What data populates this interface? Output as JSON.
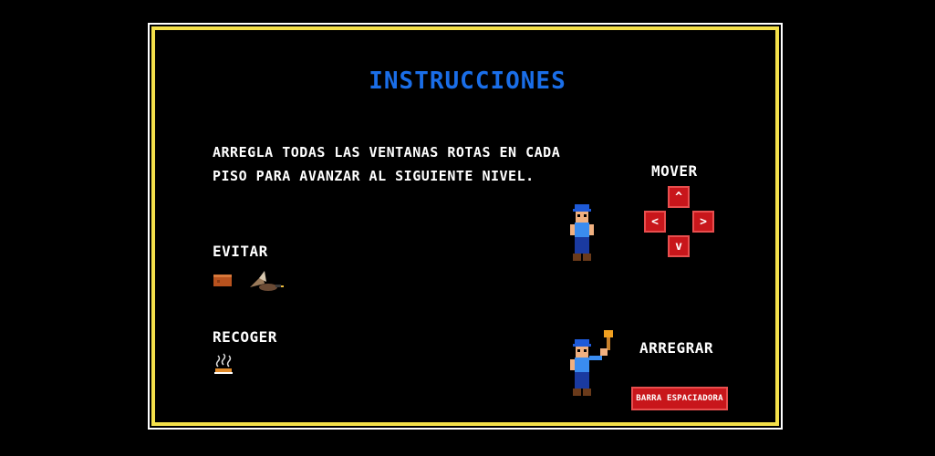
{
  "title": "INSTRUCCIONES",
  "intro": {
    "line1": "ARREGLA TODAS LAS VENTANAS ROTAS EN CADA",
    "line2": "PISO PARA AVANZAR AL SIGUIENTE NIVEL."
  },
  "sections": {
    "avoid_label": "EVITAR",
    "collect_label": "RECOGER",
    "move_label": "MOVER",
    "fix_label": "ARREGRAR"
  },
  "controls": {
    "up": "^",
    "left": "<",
    "right": ">",
    "down": "v",
    "space": "BARRA ESPACIADORA"
  },
  "icons": {
    "avoid": [
      "brick-icon",
      "duck-icon"
    ],
    "collect": [
      "pie-icon"
    ],
    "characters": [
      "fix-it-felix-standing",
      "fix-it-felix-hammer"
    ]
  },
  "colors": {
    "title": "#1a6ee8",
    "frame": "#f4e04a",
    "key": "#c8161b",
    "background": "#000000"
  }
}
